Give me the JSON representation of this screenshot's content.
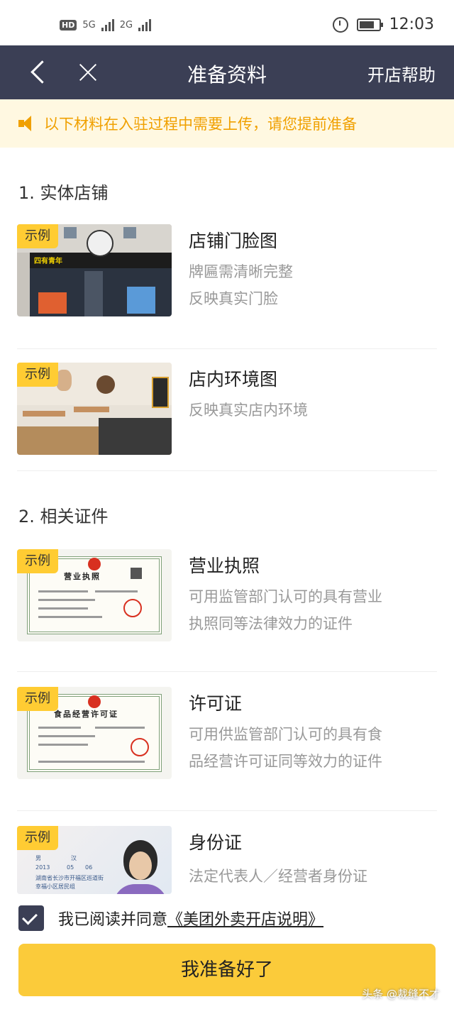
{
  "status_bar": {
    "hd": "HD",
    "net1": "5G",
    "net2": "2G",
    "time": "12:03"
  },
  "nav": {
    "title": "准备资料",
    "help": "开店帮助"
  },
  "notice": {
    "text": "以下材料在入驻过程中需要上传，请您提前准备"
  },
  "badge": "示例",
  "sections": [
    {
      "title": "1. 实体店铺",
      "items": [
        {
          "title": "店铺门脸图",
          "desc1": "牌匾需清晰完整",
          "desc2": "反映真实门脸"
        },
        {
          "title": "店内环境图",
          "desc1": "反映真实店内环境"
        }
      ]
    },
    {
      "title": "2. 相关证件",
      "items": [
        {
          "title": "营业执照",
          "desc1": "可用监管部门认可的具有营业",
          "desc2": "执照同等法律效力的证件",
          "cert_title": "营业执照"
        },
        {
          "title": "许可证",
          "desc1": "可用供监管部门认可的具有食",
          "desc2": "品经营许可证同等效力的证件",
          "cert_title": "食品经营许可证"
        },
        {
          "title": "身份证",
          "desc1": "法定代表人／经营者身份证"
        }
      ]
    }
  ],
  "store_sign": "四有青年",
  "id_card": {
    "sex": "男",
    "ethnicity": "汉",
    "year": "2013",
    "month": "05",
    "day": "06",
    "addr1": "湖南省长沙市开福区巡道街",
    "addr2": "幸福小区居民组"
  },
  "agree": {
    "prefix": "我已阅读并同意",
    "link": "《美团外卖开店说明》"
  },
  "button": {
    "label": "我准备好了"
  },
  "watermark": "头条 @裁缝不才",
  "colors": {
    "nav_bg": "#3b3f55",
    "accent": "#fbcb3a",
    "notice_text": "#f0a000"
  }
}
